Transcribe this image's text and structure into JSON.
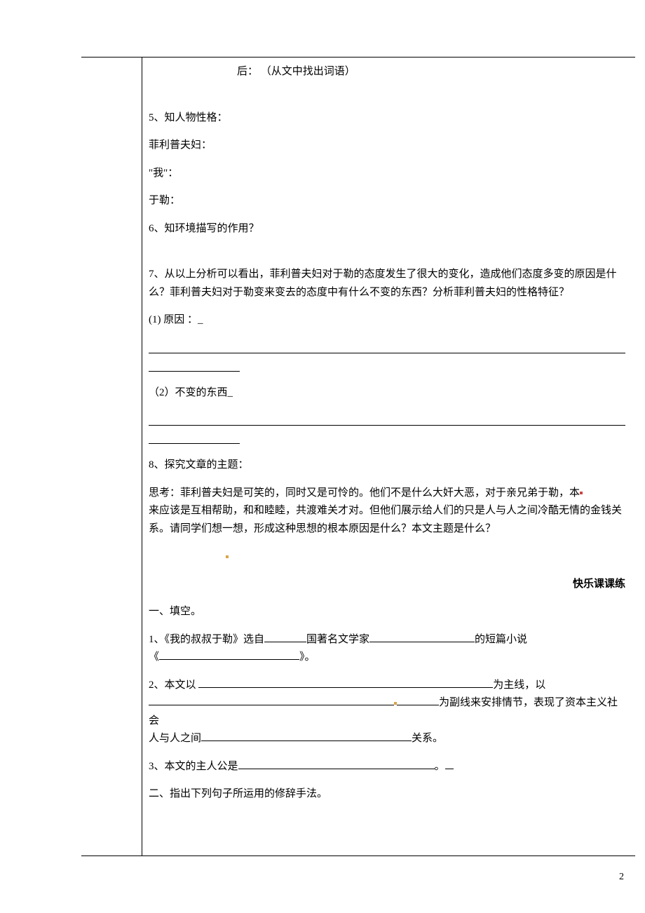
{
  "line_hou": "后：   （从文中找出词语）",
  "q5_title": "5、知人物性格：",
  "q5_a": "菲利普夫妇：",
  "q5_b": "\"我\"：",
  "q5_c": "于勒：",
  "q6": "6、知环境描写的作用？",
  "q7": "7、从以上分析可以看出，菲利普夫妇对于勒的态度发生了很大的变化，造成他们态度多变的原因是什么？菲利普夫妇对于勒变来变去的态度中有什么不变的东西？分析菲利普夫妇的性格特征？",
  "q7_sub1": "(1) 原因   ：_",
  "q7_sub2": "（2）不变的东西_",
  "q8_title": "8、探究文章的主题：",
  "q8_body": "思考：菲利普夫妇是可笑的，同时又是可怜的。他们不是什么大奸大恶，对于亲兄弟于勒，本",
  "q8_body2": "来应该是互相帮助，和和睦睦，共渡难关才对。但他们展示给人们的只是人与人之间冷酷无情的金钱关系。请同学们想一想，形成这种思想的根本原因是什么？本文主题是什么？",
  "section_title": "快乐课课练",
  "sec1_title": "一、填空。",
  "sec1_q1_a": "1、《我的叔叔于勒》选自",
  "sec1_q1_b": "国著名文学家",
  "sec1_q1_c": "的短篇小说",
  "sec1_q1_d": "《",
  "sec1_q1_e": "》。",
  "sec1_q2_a": "2、本文以",
  "sec1_q2_b": "为主线，以",
  "sec1_q2_c": "为副线来安排情节，表现了资本主义社会",
  "sec1_q2_d": "人与人之间",
  "sec1_q2_e": "关系。",
  "sec1_q3_a": "3、本文的主人公是",
  "sec1_q3_b": "。",
  "sec2_title": "二、指出下列句子所运用的修辞手法。",
  "page_number": "2"
}
